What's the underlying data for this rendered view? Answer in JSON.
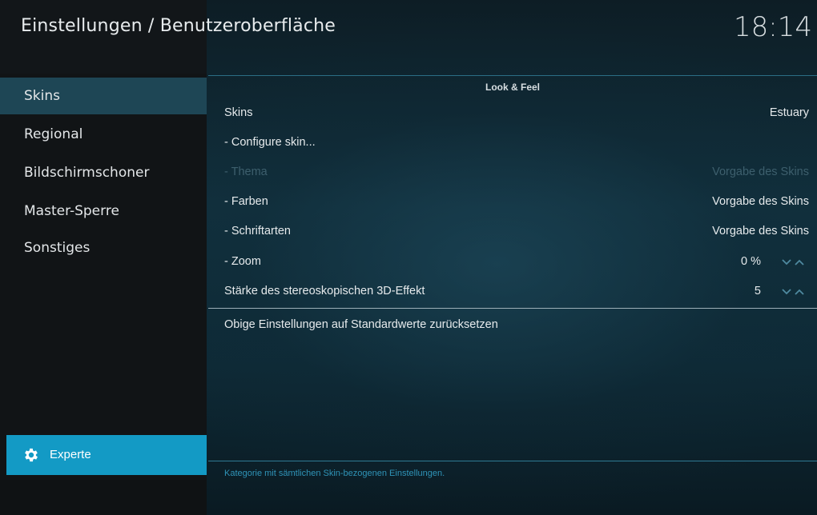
{
  "header": {
    "title": "Einstellungen / Benutzeroberfläche",
    "clock": "18:14"
  },
  "sidebar": {
    "items": [
      {
        "label": "Skins",
        "active": true
      },
      {
        "label": "Regional",
        "active": false
      },
      {
        "label": "Bildschirmschoner",
        "active": false
      },
      {
        "label": "Master-Sperre",
        "active": false
      },
      {
        "label": "Sonstiges",
        "active": false
      }
    ],
    "level_button": {
      "label": "Experte",
      "icon": "gear-icon"
    }
  },
  "content": {
    "section_title": "Look & Feel",
    "settings": [
      {
        "label": "Skins",
        "value": "Estuary",
        "disabled": false,
        "spinner": false
      },
      {
        "label": "- Configure skin...",
        "value": "",
        "disabled": false,
        "spinner": false
      },
      {
        "label": "- Thema",
        "value": "Vorgabe des Skins",
        "disabled": true,
        "spinner": false
      },
      {
        "label": "- Farben",
        "value": "Vorgabe des Skins",
        "disabled": false,
        "spinner": false
      },
      {
        "label": "- Schriftarten",
        "value": "Vorgabe des Skins",
        "disabled": false,
        "spinner": false
      },
      {
        "label": "- Zoom",
        "value": "0 %",
        "disabled": false,
        "spinner": true
      },
      {
        "label": "Stärke des stereoskopischen 3D-Effekt",
        "value": "5",
        "disabled": false,
        "spinner": true
      }
    ],
    "reset_label": "Obige Einstellungen auf Standardwerte zurücksetzen",
    "footer_hint": "Kategorie mit sämtlichen Skin-bezogenen Einstellungen."
  },
  "colors": {
    "accent": "#139ac5",
    "active_item": "#1e4655",
    "disabled_text": "#3d5f6d"
  }
}
